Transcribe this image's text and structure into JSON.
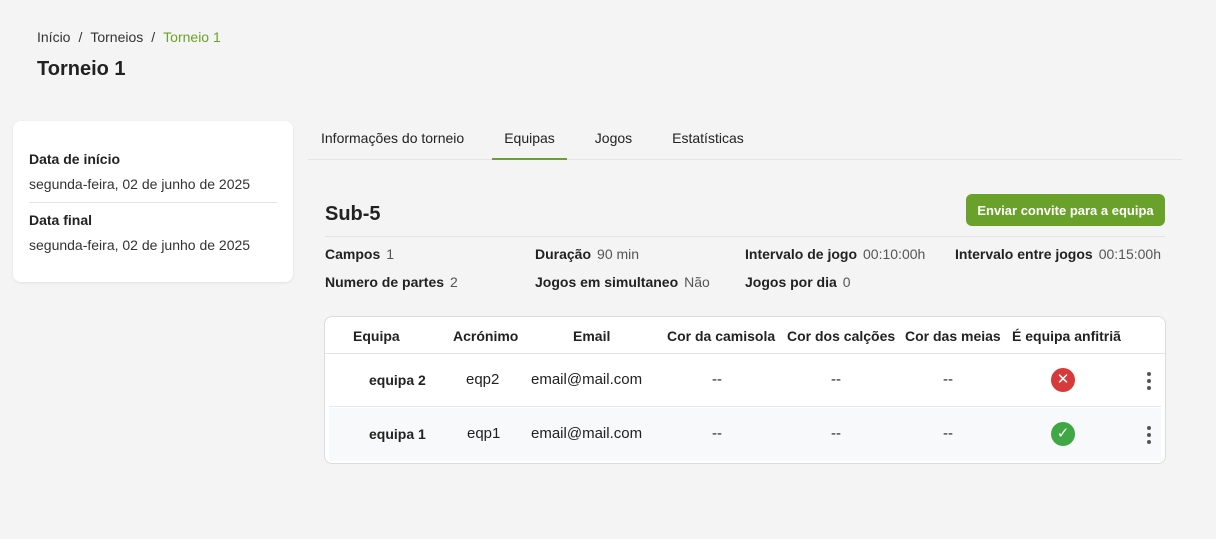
{
  "breadcrumb": {
    "home": "Início",
    "tournaments": "Torneios",
    "current": "Torneio 1",
    "separator": "/"
  },
  "page_title": "Torneio 1",
  "dates": {
    "start_label": "Data de início",
    "start_value": "segunda-feira, 02 de junho de 2025",
    "end_label": "Data final",
    "end_value": "segunda-feira, 02 de junho de 2025"
  },
  "tabs": [
    {
      "label": "Informações do torneio"
    },
    {
      "label": "Equipas",
      "active": true
    },
    {
      "label": "Jogos"
    },
    {
      "label": "Estatísticas"
    }
  ],
  "category": {
    "title": "Sub-5",
    "invite_button": "Enviar convite para a equipa",
    "meta": {
      "fields_label": "Campos",
      "fields_value": "1",
      "duration_label": "Duração",
      "duration_value": "90 min",
      "game_interval_label": "Intervalo de jogo",
      "game_interval_value": "00:10:00h",
      "between_games_label": "Intervalo entre jogos",
      "between_games_value": "00:15:00h",
      "parts_label": "Numero de partes",
      "parts_value": "2",
      "simultaneous_label": "Jogos em simultaneo",
      "simultaneous_value": "Não",
      "per_day_label": "Jogos por dia",
      "per_day_value": "0"
    }
  },
  "table": {
    "headers": [
      "Equipa",
      "Acrónimo",
      "Email",
      "Cor da camisola",
      "Cor dos calções",
      "Cor das meias",
      "É equipa anfitriã"
    ],
    "rows": [
      {
        "team": "equipa 2",
        "acronym": "eqp2",
        "email": "email@mail.com",
        "shirt": "--",
        "shorts": "--",
        "socks": "--",
        "host": "no",
        "host_icon": "x-circle-icon"
      },
      {
        "team": "equipa 1",
        "acronym": "eqp1",
        "email": "email@mail.com",
        "shirt": "--",
        "shorts": "--",
        "socks": "--",
        "host": "yes",
        "host_icon": "check-circle-icon"
      }
    ]
  },
  "colors": {
    "accent": "#6aa12a",
    "no": "#d63a3a",
    "yes": "#3fa845"
  }
}
